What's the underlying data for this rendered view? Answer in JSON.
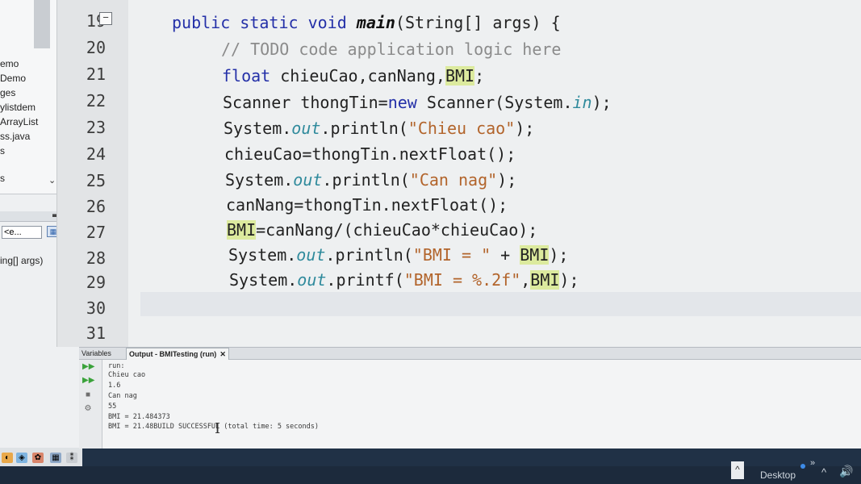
{
  "project_tree": {
    "items": [
      "emo",
      "Demo",
      "ges",
      "ylistdem",
      "ArrayList",
      "ss.java",
      "s",
      "s"
    ]
  },
  "navigator": {
    "combo_value": "<e...",
    "member": "ing[] args)"
  },
  "editor": {
    "line_numbers": [
      "19",
      "20",
      "21",
      "22",
      "23",
      "24",
      "25",
      "26",
      "27",
      "28",
      "29",
      "30",
      "31"
    ],
    "lines": {
      "l19": {
        "kw1": "public static void ",
        "method": "main",
        "rest": "(String[] args) {"
      },
      "l20": {
        "comment": "// TODO code application logic here"
      },
      "l21": {
        "kw": "float ",
        "text": "chieuCao,canNang,",
        "hl": "BMI",
        "end": ";"
      },
      "l22": {
        "a": "Scanner thongTin=",
        "kw": "new",
        "b": " Scanner(System.",
        "it": "in",
        "c": ");"
      },
      "l23": {
        "a": "System.",
        "it": "out",
        "b": ".println(",
        "st": "\"Chieu cao\"",
        "c": ");"
      },
      "l24": {
        "text": "chieuCao=thongTin.nextFloat();"
      },
      "l25": {
        "a": "System.",
        "it": "out",
        "b": ".println(",
        "st": "\"Can nag\"",
        "c": ");"
      },
      "l26": {
        "text": "canNang=thongTin.nextFloat();"
      },
      "l27": {
        "hl": "BMI",
        "rest": "=canNang/(chieuCao*chieuCao);"
      },
      "l28": {
        "a": "System.",
        "it": "out",
        "b": ".println(",
        "st": "\"BMI = \"",
        "c": " + ",
        "hl": "BMI",
        "d": ");"
      },
      "l29": {
        "a": "System.",
        "it": "out",
        "b": ".printf(",
        "st": "\"BMI = %.2f\"",
        "c": ",",
        "hl": "BMI",
        "d": ");"
      }
    }
  },
  "output": {
    "tab_variables": "Variables",
    "tab_output": "Output - BMITesting (run)",
    "tab_close": "✕",
    "lines": [
      "run:",
      "Chieu cao",
      "1.6",
      "Can nag",
      "55",
      "BMI = 21.484373",
      "BMI = 21.48BUILD SUCCESSFUL (total time: 5 seconds)"
    ]
  },
  "taskbar": {
    "desktop_label": "Desktop",
    "chevrons": "»",
    "caret": "^",
    "volume": "🔊"
  },
  "colors": {
    "keyword": "#2430a8",
    "comment": "#8b8b8b",
    "string": "#b2642b",
    "static_field": "#2f8a9c",
    "occurrence_highlight": "#dcea9e"
  }
}
